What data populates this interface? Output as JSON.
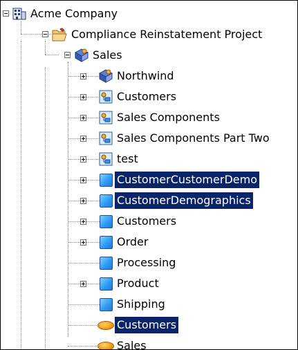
{
  "tree": {
    "root": {
      "label": "Acme Company",
      "icon": "company-icon",
      "expanded": true
    },
    "project": {
      "label": "Compliance Reinstatement  Project",
      "icon": "folder-open-icon",
      "expanded": true
    },
    "model": {
      "label": "Sales",
      "icon": "model-icon",
      "expanded": true
    },
    "children": [
      {
        "label": "Northwind",
        "icon": "model-icon",
        "expandable": true,
        "selected": false
      },
      {
        "label": "Customers",
        "icon": "diagram-icon",
        "expandable": true,
        "selected": false
      },
      {
        "label": "Sales Components",
        "icon": "diagram-icon",
        "expandable": true,
        "selected": false
      },
      {
        "label": "Sales Components Part Two",
        "icon": "diagram-icon",
        "expandable": true,
        "selected": false
      },
      {
        "label": "test",
        "icon": "diagram-icon",
        "expandable": true,
        "selected": false
      },
      {
        "label": "CustomerCustomerDemo",
        "icon": "entity-icon",
        "expandable": true,
        "selected": true
      },
      {
        "label": "CustomerDemographics",
        "icon": "entity-icon",
        "expandable": true,
        "selected": true
      },
      {
        "label": "Customers",
        "icon": "entity-icon",
        "expandable": true,
        "selected": false
      },
      {
        "label": "Order",
        "icon": "entity-icon",
        "expandable": true,
        "selected": false
      },
      {
        "label": "Processing",
        "icon": "entity-icon",
        "expandable": false,
        "selected": false
      },
      {
        "label": "Product",
        "icon": "entity-icon",
        "expandable": true,
        "selected": false
      },
      {
        "label": "Shipping",
        "icon": "entity-icon",
        "expandable": false,
        "selected": false
      },
      {
        "label": "Customers",
        "icon": "ellipse-icon",
        "expandable": false,
        "selected": true
      },
      {
        "label": "Sales",
        "icon": "ellipse-icon",
        "expandable": false,
        "selected": false
      }
    ]
  },
  "colors": {
    "selection": "#0a246a",
    "selection_text": "#ffffff",
    "entity_blue": "#2f9df5",
    "ellipse_orange": "#f29b14"
  }
}
